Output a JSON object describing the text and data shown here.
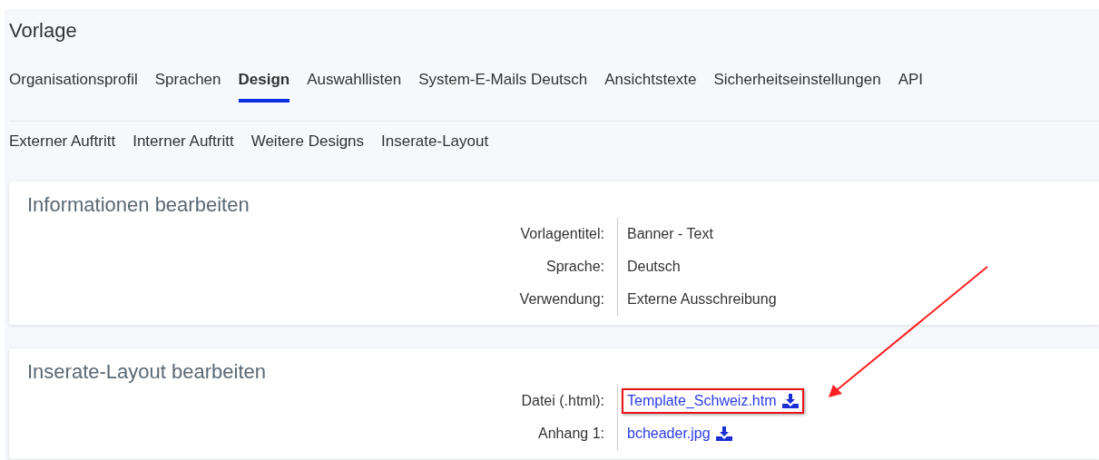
{
  "page_title": "Vorlage",
  "tabs": [
    {
      "label": "Organisationsprofil",
      "selected": false
    },
    {
      "label": "Sprachen",
      "selected": false
    },
    {
      "label": "Design",
      "selected": true
    },
    {
      "label": "Auswahllisten",
      "selected": false
    },
    {
      "label": "System-E-Mails Deutsch",
      "selected": false
    },
    {
      "label": "Ansichtstexte",
      "selected": false
    },
    {
      "label": "Sicherheitseinstellungen",
      "selected": false
    },
    {
      "label": "API",
      "selected": false
    }
  ],
  "subtabs": [
    "Externer Auftritt",
    "Interner Auftritt",
    "Weitere Designs",
    "Inserate-Layout"
  ],
  "sections": [
    {
      "heading": "Informationen bearbeiten",
      "rows": [
        {
          "label": "Vorlagentitel:",
          "value": "Banner - Text",
          "kind": "text"
        },
        {
          "label": "Sprache:",
          "value": "Deutsch",
          "kind": "text"
        },
        {
          "label": "Verwendung:",
          "value": "Externe Ausschreibung",
          "kind": "text"
        }
      ]
    },
    {
      "heading": "Inserate-Layout bearbeiten",
      "rows": [
        {
          "label": "Datei (.html):",
          "value": "Template_Schweiz.htm",
          "kind": "file",
          "highlighted": true
        },
        {
          "label": "Anhang 1:",
          "value": "bcheader.jpg",
          "kind": "file",
          "highlighted": false
        }
      ]
    }
  ]
}
